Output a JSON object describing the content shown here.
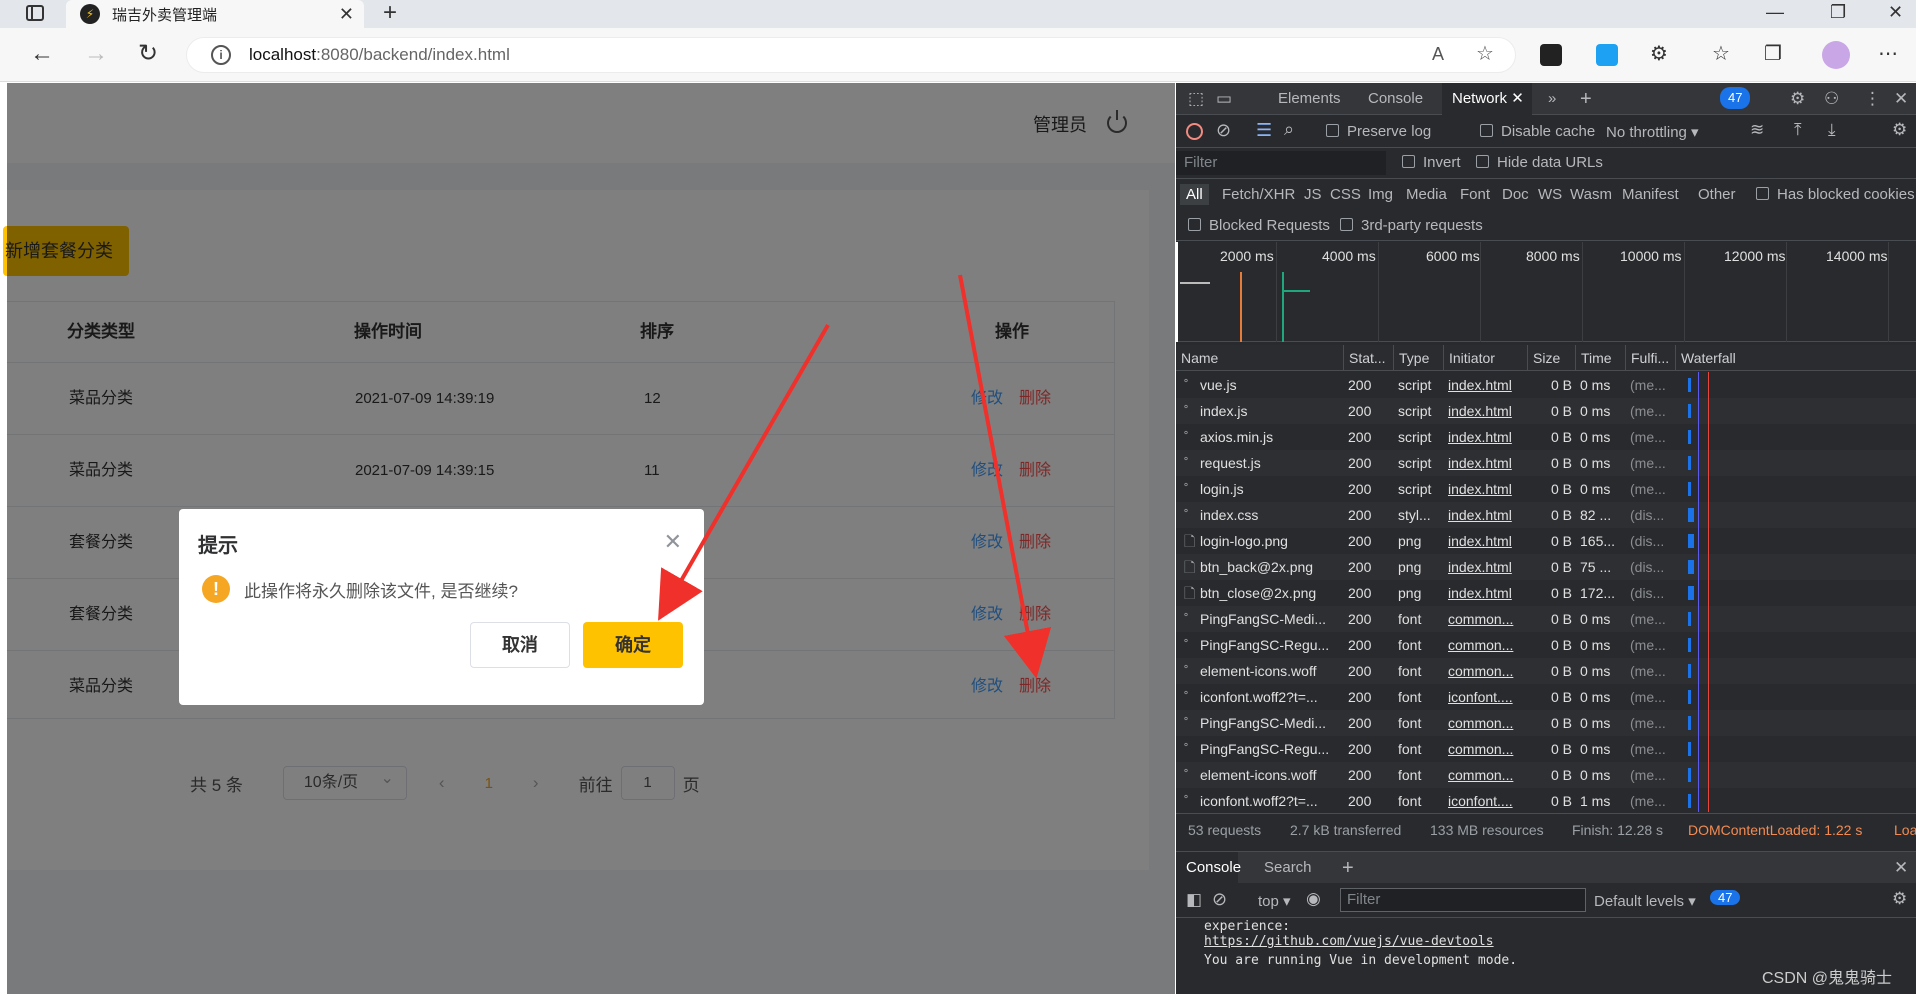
{
  "browser": {
    "tab_title": "瑞吉外卖管理端",
    "url_host": "localhost",
    "url_path": ":8080/backend/index.html"
  },
  "app": {
    "admin_label": "管理员",
    "add_button": "新增套餐分类",
    "columns": [
      "分类类型",
      "操作时间",
      "排序",
      "操作"
    ],
    "rows": [
      {
        "type": "菜品分类",
        "time": "2021-07-09 14:39:19",
        "sort": "12",
        "edit": "修改",
        "delete": "删除"
      },
      {
        "type": "菜品分类",
        "time": "2021-07-09 14:39:15",
        "sort": "11",
        "edit": "修改",
        "delete": "删除"
      },
      {
        "type": "套餐分类",
        "time": "",
        "sort": "",
        "edit": "修改",
        "delete": "删除"
      },
      {
        "type": "套餐分类",
        "time": "",
        "sort": "",
        "edit": "修改",
        "delete": "删除"
      },
      {
        "type": "菜品分类",
        "time": "",
        "sort": "",
        "edit": "修改",
        "delete": "删除"
      }
    ],
    "pager": {
      "total": "共 5 条",
      "page_size": "10条/页",
      "current": "1",
      "goto_label": "前往",
      "goto_value": "1",
      "page_suffix": "页"
    }
  },
  "dialog": {
    "title": "提示",
    "message": "此操作将永久删除该文件, 是否继续?",
    "cancel": "取消",
    "confirm": "确定"
  },
  "devtools": {
    "tabs": [
      "Elements",
      "Console",
      "Network"
    ],
    "active_tab": "Network",
    "issues_count": "47",
    "toolbar": {
      "preserve_log": "Preserve log",
      "disable_cache": "Disable cache",
      "throttling": "No throttling"
    },
    "filter_placeholder": "Filter",
    "invert": "Invert",
    "hide_data_urls": "Hide data URLs",
    "types": [
      "All",
      "Fetch/XHR",
      "JS",
      "CSS",
      "Img",
      "Media",
      "Font",
      "Doc",
      "WS",
      "Wasm",
      "Manifest",
      "Other"
    ],
    "has_blocked_cookies": "Has blocked cookies",
    "blocked_requests": "Blocked Requests",
    "third_party": "3rd-party requests",
    "timeline_ticks": [
      "2000 ms",
      "4000 ms",
      "6000 ms",
      "8000 ms",
      "10000 ms",
      "12000 ms",
      "14000 ms"
    ],
    "columns": [
      "Name",
      "Stat...",
      "Type",
      "Initiator",
      "Size",
      "Time",
      "Fulfi...",
      "Waterfall"
    ],
    "requests": [
      {
        "name": "vue.js",
        "status": "200",
        "type": "script",
        "initiator": "index.html",
        "size": "0 B",
        "time": "0 ms",
        "fulfilled": "(me..."
      },
      {
        "name": "index.js",
        "status": "200",
        "type": "script",
        "initiator": "index.html",
        "size": "0 B",
        "time": "0 ms",
        "fulfilled": "(me..."
      },
      {
        "name": "axios.min.js",
        "status": "200",
        "type": "script",
        "initiator": "index.html",
        "size": "0 B",
        "time": "0 ms",
        "fulfilled": "(me..."
      },
      {
        "name": "request.js",
        "status": "200",
        "type": "script",
        "initiator": "index.html",
        "size": "0 B",
        "time": "0 ms",
        "fulfilled": "(me..."
      },
      {
        "name": "login.js",
        "status": "200",
        "type": "script",
        "initiator": "index.html",
        "size": "0 B",
        "time": "0 ms",
        "fulfilled": "(me..."
      },
      {
        "name": "index.css",
        "status": "200",
        "type": "styl...",
        "initiator": "index.html",
        "size": "0 B",
        "time": "82 ...",
        "fulfilled": "(dis..."
      },
      {
        "name": "login-logo.png",
        "status": "200",
        "type": "png",
        "initiator": "index.html",
        "size": "0 B",
        "time": "165...",
        "fulfilled": "(dis..."
      },
      {
        "name": "btn_back@2x.png",
        "status": "200",
        "type": "png",
        "initiator": "index.html",
        "size": "0 B",
        "time": "75 ...",
        "fulfilled": "(dis..."
      },
      {
        "name": "btn_close@2x.png",
        "status": "200",
        "type": "png",
        "initiator": "index.html",
        "size": "0 B",
        "time": "172...",
        "fulfilled": "(dis..."
      },
      {
        "name": "PingFangSC-Medi...",
        "status": "200",
        "type": "font",
        "initiator": "common...",
        "size": "0 B",
        "time": "0 ms",
        "fulfilled": "(me..."
      },
      {
        "name": "PingFangSC-Regu...",
        "status": "200",
        "type": "font",
        "initiator": "common...",
        "size": "0 B",
        "time": "0 ms",
        "fulfilled": "(me..."
      },
      {
        "name": "element-icons.woff",
        "status": "200",
        "type": "font",
        "initiator": "common...",
        "size": "0 B",
        "time": "0 ms",
        "fulfilled": "(me..."
      },
      {
        "name": "iconfont.woff2?t=...",
        "status": "200",
        "type": "font",
        "initiator": "iconfont....",
        "size": "0 B",
        "time": "0 ms",
        "fulfilled": "(me..."
      },
      {
        "name": "PingFangSC-Medi...",
        "status": "200",
        "type": "font",
        "initiator": "common...",
        "size": "0 B",
        "time": "0 ms",
        "fulfilled": "(me..."
      },
      {
        "name": "PingFangSC-Regu...",
        "status": "200",
        "type": "font",
        "initiator": "common...",
        "size": "0 B",
        "time": "0 ms",
        "fulfilled": "(me..."
      },
      {
        "name": "element-icons.woff",
        "status": "200",
        "type": "font",
        "initiator": "common...",
        "size": "0 B",
        "time": "0 ms",
        "fulfilled": "(me..."
      },
      {
        "name": "iconfont.woff2?t=...",
        "status": "200",
        "type": "font",
        "initiator": "iconfont....",
        "size": "0 B",
        "time": "1 ms",
        "fulfilled": "(me..."
      }
    ],
    "status": {
      "requests": "53 requests",
      "transferred": "2.7 kB transferred",
      "resources": "133 MB resources",
      "finish": "Finish: 12.28 s",
      "dcl": "DOMContentLoaded: 1.22 s",
      "load": "Loa"
    },
    "console": {
      "tabs": [
        "Console",
        "Search"
      ],
      "context": "top",
      "filter_placeholder": "Filter",
      "levels": "Default levels",
      "issues": "47",
      "lines": [
        "experience:",
        "https://github.com/vuejs/vue-devtools",
        "You are running Vue in development mode."
      ]
    }
  },
  "watermark": "CSDN @鬼鬼骑士",
  "colors": {
    "accent": "#ffc200",
    "edit": "#419eff",
    "delete": "#ff4f4f",
    "network_tab_bg": "#292a2d"
  }
}
